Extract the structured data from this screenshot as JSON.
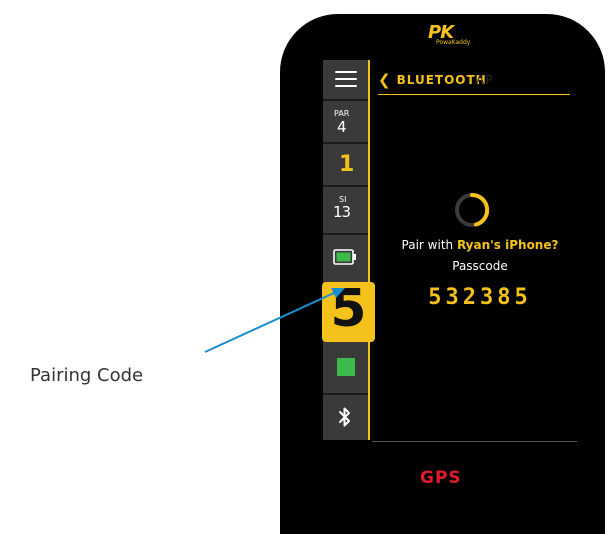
{
  "device": {
    "brand_mark": "PK",
    "brand_name": "PowaKaddy"
  },
  "sidebar": {
    "menu_icon": "hamburger-menu-icon",
    "par_label": "PAR",
    "par_value": "4",
    "hole_number": "1",
    "si_label": "SI",
    "si_value": "13",
    "battery_icon": "battery-icon",
    "gear_value": "5",
    "status_square_color": "#3cba4c",
    "bluetooth_icon": "bluetooth-icon"
  },
  "header": {
    "back_icon": "chevron-left-icon",
    "title": "BLUETOOTH",
    "ghost_text": "AP"
  },
  "pairing": {
    "spinner_icon": "loading-spinner-icon",
    "prompt_prefix": "Pair with",
    "device_name": "Ryan's iPhone?",
    "passcode_label": "Passcode",
    "passcode": "532385"
  },
  "footer": {
    "mode_label": "GPS"
  },
  "annotation": {
    "label": "Pairing Code"
  },
  "colors": {
    "accent": "#f5c21b",
    "gps_red": "#e21b2a",
    "sidebar_gray": "#3a3a3a"
  }
}
